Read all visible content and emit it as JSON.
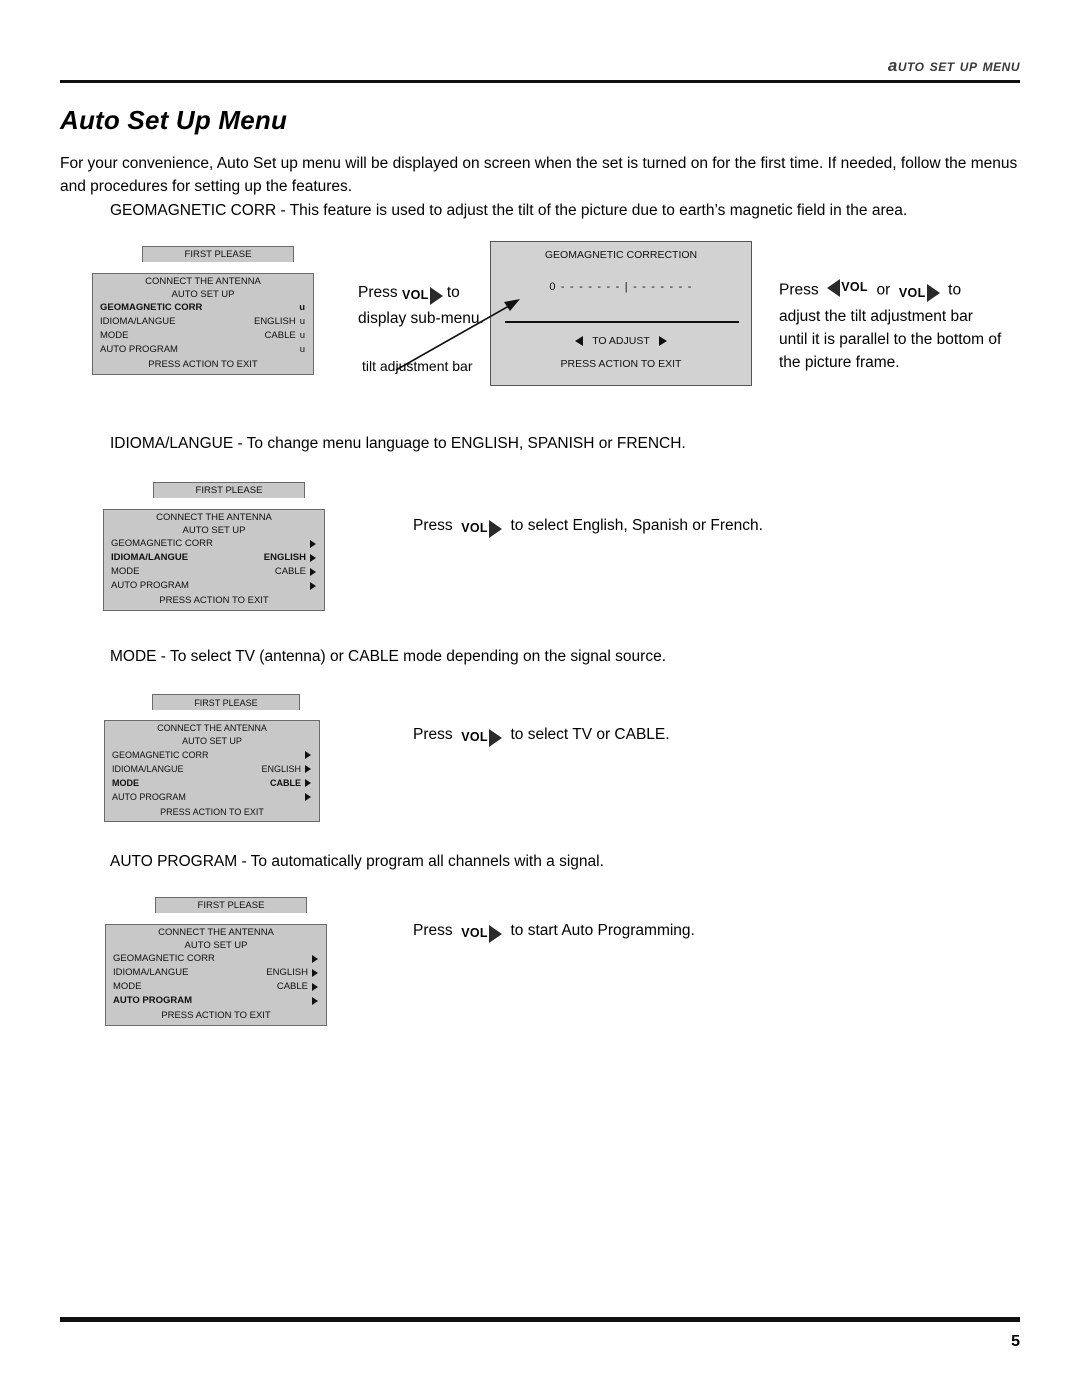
{
  "header": {
    "running_head": "Auto Set Up Menu",
    "page_title": "Auto Set Up Menu"
  },
  "intro": "For your convenience, Auto Set up menu will be displayed on screen when the set is turned on for the first time. If needed, follow the menus and procedures for setting up the features.",
  "sections": {
    "geomagnetic": "GEOMAGNETIC CORR  - This feature is used to adjust the tilt of the picture due to earth’s magnetic field in the area.",
    "idioma": "IDIOMA/LANGUE - To change menu language to ENGLISH, SPANISH or FRENCH.",
    "mode": "MODE - To select TV (antenna) or CABLE mode depending on the signal source.",
    "auto_program": "AUTO PROGRAM - To automatically program all channels with a signal."
  },
  "osd": {
    "tab_line1": "FIRST PLEASE",
    "tab_line2": "CONNECT THE ANTENNA",
    "subtitle": "AUTO SET UP",
    "footer": "PRESS ACTION TO EXIT",
    "arrow_glyph": "u",
    "rows": {
      "geomagnetic": "GEOMAGNETIC CORR",
      "idioma": "IDIOMA/LANGUE",
      "mode": "MODE",
      "auto_program": "AUTO PROGRAM"
    },
    "values": {
      "english": "ENGLISH",
      "cable": "CABLE"
    }
  },
  "submenu": {
    "title": "GEOMAGNETIC CORRECTION",
    "scale": "0 - - - - - - - | - - - - - - -",
    "adjust": "TO ADJUST",
    "footer": "PRESS ACTION TO EXIT",
    "callout": "tilt adjustment bar"
  },
  "instructions": {
    "geo_left": {
      "press": "Press",
      "vol": "VOL",
      "to": "to",
      "line2": "display sub-menu."
    },
    "geo_right": {
      "press": "Press",
      "vol": "VOL",
      "or": "or",
      "to": "to",
      "line2": "adjust the tilt adjustment bar",
      "line3": "until it is parallel to the bottom of",
      "line4": "the picture frame."
    },
    "idioma": {
      "press": "Press",
      "vol": "VOL",
      "tail": "to select English, Spanish or French."
    },
    "mode": {
      "press": "Press",
      "vol": "VOL",
      "tail": "to select TV or CABLE."
    },
    "auto_program": {
      "press": "Press",
      "vol": "VOL",
      "tail": "to start Auto Programming."
    }
  },
  "footer": {
    "page_number": "5"
  }
}
